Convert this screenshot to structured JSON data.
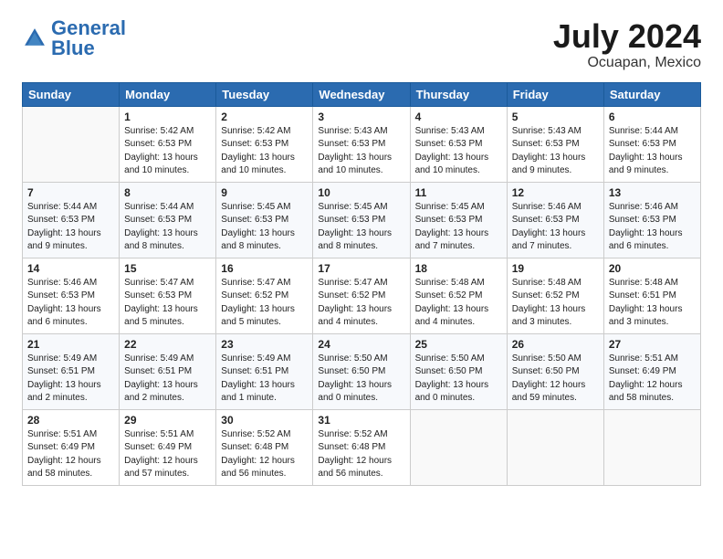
{
  "logo": {
    "text_general": "General",
    "text_blue": "Blue"
  },
  "header": {
    "month": "July 2024",
    "location": "Ocuapan, Mexico"
  },
  "weekdays": [
    "Sunday",
    "Monday",
    "Tuesday",
    "Wednesday",
    "Thursday",
    "Friday",
    "Saturday"
  ],
  "weeks": [
    [
      {
        "day": "",
        "sunrise": "",
        "sunset": "",
        "daylight": ""
      },
      {
        "day": "1",
        "sunrise": "Sunrise: 5:42 AM",
        "sunset": "Sunset: 6:53 PM",
        "daylight": "Daylight: 13 hours and 10 minutes."
      },
      {
        "day": "2",
        "sunrise": "Sunrise: 5:42 AM",
        "sunset": "Sunset: 6:53 PM",
        "daylight": "Daylight: 13 hours and 10 minutes."
      },
      {
        "day": "3",
        "sunrise": "Sunrise: 5:43 AM",
        "sunset": "Sunset: 6:53 PM",
        "daylight": "Daylight: 13 hours and 10 minutes."
      },
      {
        "day": "4",
        "sunrise": "Sunrise: 5:43 AM",
        "sunset": "Sunset: 6:53 PM",
        "daylight": "Daylight: 13 hours and 10 minutes."
      },
      {
        "day": "5",
        "sunrise": "Sunrise: 5:43 AM",
        "sunset": "Sunset: 6:53 PM",
        "daylight": "Daylight: 13 hours and 9 minutes."
      },
      {
        "day": "6",
        "sunrise": "Sunrise: 5:44 AM",
        "sunset": "Sunset: 6:53 PM",
        "daylight": "Daylight: 13 hours and 9 minutes."
      }
    ],
    [
      {
        "day": "7",
        "sunrise": "Sunrise: 5:44 AM",
        "sunset": "Sunset: 6:53 PM",
        "daylight": "Daylight: 13 hours and 9 minutes."
      },
      {
        "day": "8",
        "sunrise": "Sunrise: 5:44 AM",
        "sunset": "Sunset: 6:53 PM",
        "daylight": "Daylight: 13 hours and 8 minutes."
      },
      {
        "day": "9",
        "sunrise": "Sunrise: 5:45 AM",
        "sunset": "Sunset: 6:53 PM",
        "daylight": "Daylight: 13 hours and 8 minutes."
      },
      {
        "day": "10",
        "sunrise": "Sunrise: 5:45 AM",
        "sunset": "Sunset: 6:53 PM",
        "daylight": "Daylight: 13 hours and 8 minutes."
      },
      {
        "day": "11",
        "sunrise": "Sunrise: 5:45 AM",
        "sunset": "Sunset: 6:53 PM",
        "daylight": "Daylight: 13 hours and 7 minutes."
      },
      {
        "day": "12",
        "sunrise": "Sunrise: 5:46 AM",
        "sunset": "Sunset: 6:53 PM",
        "daylight": "Daylight: 13 hours and 7 minutes."
      },
      {
        "day": "13",
        "sunrise": "Sunrise: 5:46 AM",
        "sunset": "Sunset: 6:53 PM",
        "daylight": "Daylight: 13 hours and 6 minutes."
      }
    ],
    [
      {
        "day": "14",
        "sunrise": "Sunrise: 5:46 AM",
        "sunset": "Sunset: 6:53 PM",
        "daylight": "Daylight: 13 hours and 6 minutes."
      },
      {
        "day": "15",
        "sunrise": "Sunrise: 5:47 AM",
        "sunset": "Sunset: 6:53 PM",
        "daylight": "Daylight: 13 hours and 5 minutes."
      },
      {
        "day": "16",
        "sunrise": "Sunrise: 5:47 AM",
        "sunset": "Sunset: 6:52 PM",
        "daylight": "Daylight: 13 hours and 5 minutes."
      },
      {
        "day": "17",
        "sunrise": "Sunrise: 5:47 AM",
        "sunset": "Sunset: 6:52 PM",
        "daylight": "Daylight: 13 hours and 4 minutes."
      },
      {
        "day": "18",
        "sunrise": "Sunrise: 5:48 AM",
        "sunset": "Sunset: 6:52 PM",
        "daylight": "Daylight: 13 hours and 4 minutes."
      },
      {
        "day": "19",
        "sunrise": "Sunrise: 5:48 AM",
        "sunset": "Sunset: 6:52 PM",
        "daylight": "Daylight: 13 hours and 3 minutes."
      },
      {
        "day": "20",
        "sunrise": "Sunrise: 5:48 AM",
        "sunset": "Sunset: 6:51 PM",
        "daylight": "Daylight: 13 hours and 3 minutes."
      }
    ],
    [
      {
        "day": "21",
        "sunrise": "Sunrise: 5:49 AM",
        "sunset": "Sunset: 6:51 PM",
        "daylight": "Daylight: 13 hours and 2 minutes."
      },
      {
        "day": "22",
        "sunrise": "Sunrise: 5:49 AM",
        "sunset": "Sunset: 6:51 PM",
        "daylight": "Daylight: 13 hours and 2 minutes."
      },
      {
        "day": "23",
        "sunrise": "Sunrise: 5:49 AM",
        "sunset": "Sunset: 6:51 PM",
        "daylight": "Daylight: 13 hours and 1 minute."
      },
      {
        "day": "24",
        "sunrise": "Sunrise: 5:50 AM",
        "sunset": "Sunset: 6:50 PM",
        "daylight": "Daylight: 13 hours and 0 minutes."
      },
      {
        "day": "25",
        "sunrise": "Sunrise: 5:50 AM",
        "sunset": "Sunset: 6:50 PM",
        "daylight": "Daylight: 13 hours and 0 minutes."
      },
      {
        "day": "26",
        "sunrise": "Sunrise: 5:50 AM",
        "sunset": "Sunset: 6:50 PM",
        "daylight": "Daylight: 12 hours and 59 minutes."
      },
      {
        "day": "27",
        "sunrise": "Sunrise: 5:51 AM",
        "sunset": "Sunset: 6:49 PM",
        "daylight": "Daylight: 12 hours and 58 minutes."
      }
    ],
    [
      {
        "day": "28",
        "sunrise": "Sunrise: 5:51 AM",
        "sunset": "Sunset: 6:49 PM",
        "daylight": "Daylight: 12 hours and 58 minutes."
      },
      {
        "day": "29",
        "sunrise": "Sunrise: 5:51 AM",
        "sunset": "Sunset: 6:49 PM",
        "daylight": "Daylight: 12 hours and 57 minutes."
      },
      {
        "day": "30",
        "sunrise": "Sunrise: 5:52 AM",
        "sunset": "Sunset: 6:48 PM",
        "daylight": "Daylight: 12 hours and 56 minutes."
      },
      {
        "day": "31",
        "sunrise": "Sunrise: 5:52 AM",
        "sunset": "Sunset: 6:48 PM",
        "daylight": "Daylight: 12 hours and 56 minutes."
      },
      {
        "day": "",
        "sunrise": "",
        "sunset": "",
        "daylight": ""
      },
      {
        "day": "",
        "sunrise": "",
        "sunset": "",
        "daylight": ""
      },
      {
        "day": "",
        "sunrise": "",
        "sunset": "",
        "daylight": ""
      }
    ]
  ]
}
